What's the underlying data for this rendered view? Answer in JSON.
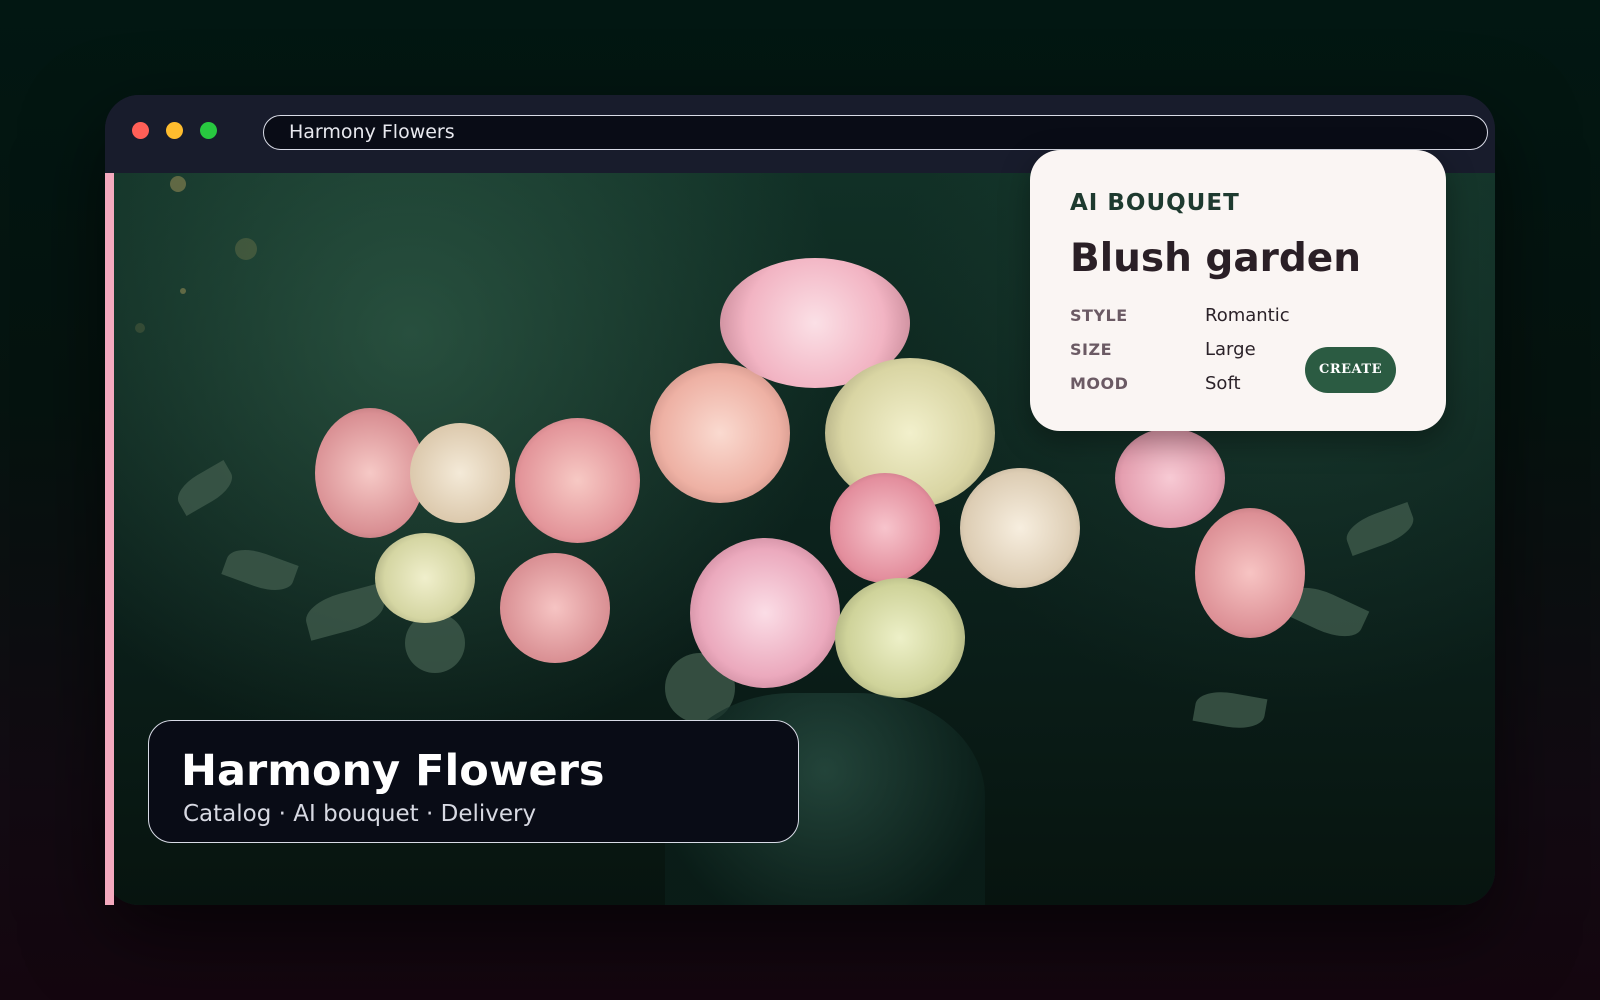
{
  "browser": {
    "address": "Harmony Flowers"
  },
  "ai_card": {
    "kicker": "AI BOUQUET",
    "title": "Blush garden",
    "specs": [
      {
        "label": "STYLE",
        "value": "Romantic"
      },
      {
        "label": "SIZE",
        "value": "Large"
      },
      {
        "label": "MOOD",
        "value": "Soft"
      }
    ],
    "create_label": "CREATE"
  },
  "brand": {
    "title": "Harmony Flowers",
    "subtitle": "Catalog · AI bouquet · Delivery"
  },
  "colors": {
    "accent_pink": "#f4a9be",
    "button_green": "#2b5b42",
    "card_bg": "#faf5f3"
  }
}
